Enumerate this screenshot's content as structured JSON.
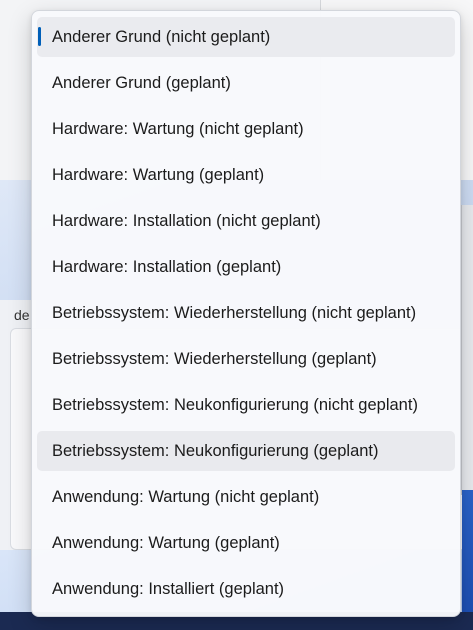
{
  "background": {
    "partial_text": "de"
  },
  "dropdown": {
    "accent_color": "#005fb8",
    "selected_index": 0,
    "hover_index": 9,
    "options": [
      {
        "label": "Anderer Grund (nicht geplant)"
      },
      {
        "label": "Anderer Grund (geplant)"
      },
      {
        "label": "Hardware: Wartung (nicht geplant)"
      },
      {
        "label": "Hardware: Wartung (geplant)"
      },
      {
        "label": "Hardware: Installation (nicht geplant)"
      },
      {
        "label": "Hardware: Installation (geplant)"
      },
      {
        "label": "Betriebssystem: Wiederherstellung (nicht geplant)"
      },
      {
        "label": "Betriebssystem: Wiederherstellung (geplant)"
      },
      {
        "label": "Betriebssystem: Neukonfigurierung (nicht geplant)"
      },
      {
        "label": "Betriebssystem: Neukonfigurierung (geplant)"
      },
      {
        "label": "Anwendung: Wartung (nicht geplant)"
      },
      {
        "label": "Anwendung: Wartung (geplant)"
      },
      {
        "label": "Anwendung: Installiert (geplant)"
      }
    ]
  }
}
